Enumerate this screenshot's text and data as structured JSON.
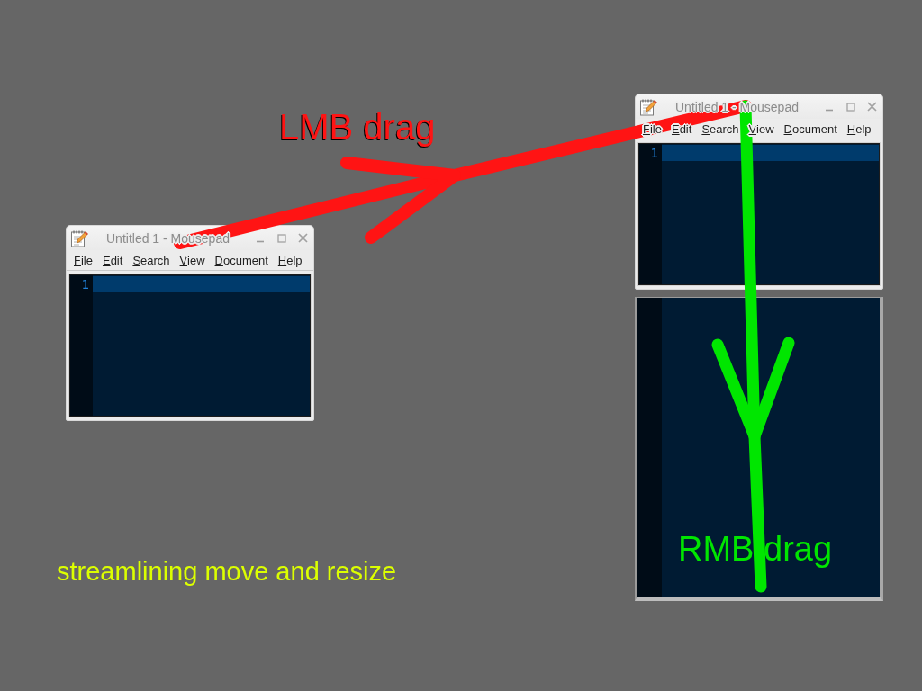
{
  "desktop": {
    "windows": [
      {
        "kind": "normal",
        "title": "Untitled 1 - Mousepad",
        "menu": [
          "File",
          "Edit",
          "Search",
          "View",
          "Document",
          "Help"
        ],
        "line_numbers": [
          "1"
        ]
      },
      {
        "kind": "resizing",
        "title": "Untitled 1 - Mousepad",
        "menu": [
          "File",
          "Edit",
          "Search",
          "View",
          "Document",
          "Help"
        ],
        "line_numbers": [
          "1"
        ]
      }
    ],
    "annotations": [
      {
        "kind": "arrow",
        "label": "LMB drag",
        "color": "#ff1414"
      },
      {
        "kind": "arrow",
        "label": "RMB drag",
        "color": "#00e600"
      }
    ],
    "caption": "streamlining move and resize"
  }
}
